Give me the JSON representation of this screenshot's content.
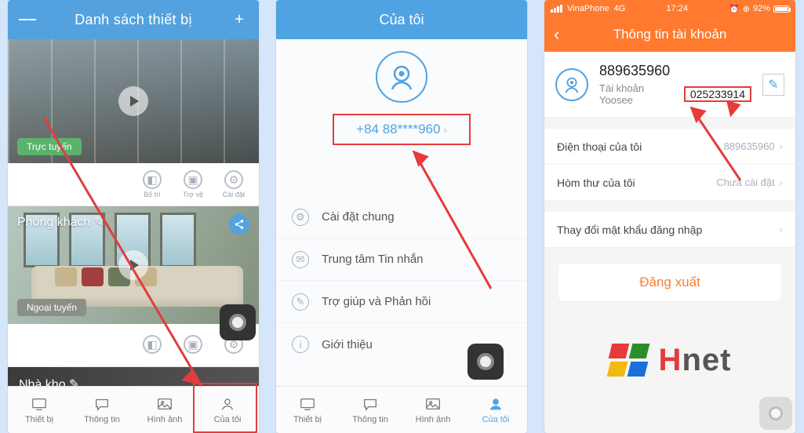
{
  "colors": {
    "blue": "#4fa3e3",
    "orange": "#ff7a2f",
    "red": "#e63b3b"
  },
  "phone1": {
    "header_title": "Danh sách thiết bị",
    "status_online": "Trực tuyến",
    "room_name": "Phòng khách",
    "status_offline": "Ngoại tuyến",
    "action_labels": {
      "a": "Bố trí",
      "b": "Trợ vệ",
      "c": "Cài đặt"
    },
    "third_room": "Nhà kho",
    "nav": {
      "devices": "Thiết bị",
      "info": "Thông tin",
      "images": "Hình ảnh",
      "mine": "Của tôi"
    }
  },
  "phone2": {
    "header_title": "Của tôi",
    "masked_phone": "+84 88****960",
    "menu": {
      "general": "Cài đặt chung",
      "msgcenter": "Trung tâm Tin nhắn",
      "help": "Trợ giúp và Phản hồi",
      "about": "Giới thiệu"
    },
    "nav": {
      "devices": "Thiết bị",
      "info": "Thông tin",
      "images": "Hình ảnh",
      "mine": "Của tôi"
    }
  },
  "phone3": {
    "status_bar": {
      "carrier": "VinaPhone",
      "net": "4G",
      "time": "17:24",
      "battery": "92%"
    },
    "header_title": "Thông tin tài khoản",
    "account": {
      "number": "889635960",
      "sub_label": "Tài khoản Yoosee",
      "sub_id": "025233914"
    },
    "rows": {
      "phone_label": "Điện thoại của tôi",
      "phone_value": "889635960",
      "mail_label": "Hòm thư của tôi",
      "mail_value": "Chưa cài đặt",
      "pwd_label": "Thay đổi mật khẩu đăng nhập"
    },
    "logout": "Đăng xuất",
    "brand": {
      "h": "H",
      "rest": "net"
    }
  }
}
